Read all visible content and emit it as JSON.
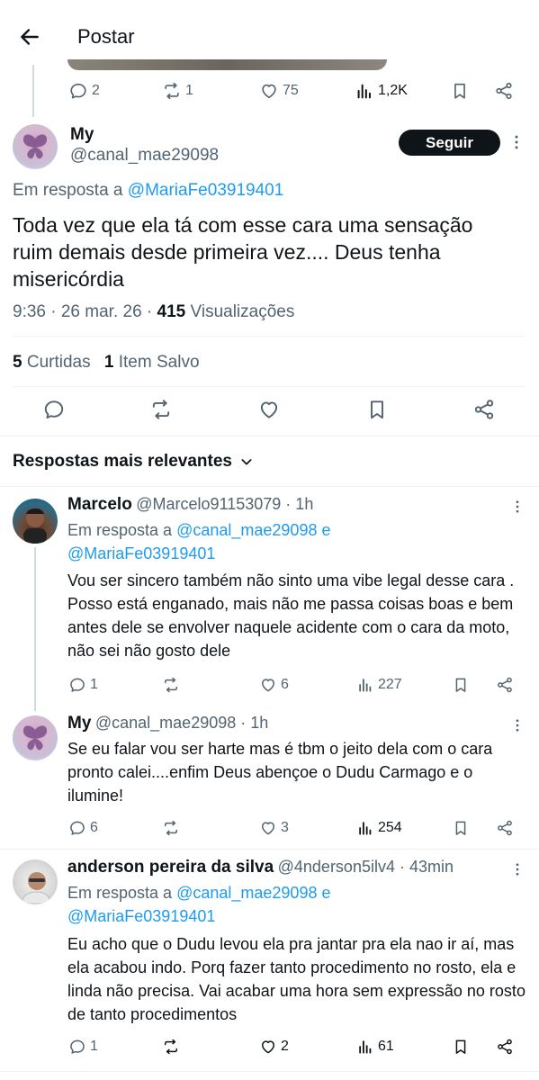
{
  "header": {
    "title": "Postar"
  },
  "prev_post_actions": {
    "replies": "2",
    "reposts": "1",
    "likes": "75",
    "views": "1,2K"
  },
  "main_post": {
    "name": "My",
    "handle": "@canal_mae29098",
    "follow_label": "Seguir",
    "reply_prefix": "Em resposta a",
    "reply_to": "@MariaFe03919401",
    "text": "Toda vez que ela tá com esse cara uma sensação ruim demais desde primeira vez.... Deus tenha misericórdia",
    "time": "9:36 · 26 mar. 26 ·",
    "views_count": "415",
    "views_label": "Visualizações",
    "likes_count": "5",
    "likes_label": "Curtidas",
    "saves_count": "1",
    "saves_label": "Item Salvo"
  },
  "sort_label": "Respostas mais relevantes",
  "replies": [
    {
      "name": "Marcelo",
      "handle": "@Marcelo91153079 · 1h",
      "reply_prefix": "Em resposta a",
      "reply_to_1": "@canal_mae29098 e",
      "reply_to_2": "@MariaFe03919401",
      "text": "Vou ser sincero também não sinto uma vibe legal desse cara . Posso está enganado, mais não me passa coisas boas e bem antes dele se envolver naquele acidente com o cara da moto, não sei não gosto dele",
      "replies": "1",
      "reposts": "",
      "likes": "6",
      "views": "227"
    },
    {
      "name": "My",
      "handle": "@canal_mae29098 · 1h",
      "text": "Se eu falar vou ser harte mas é tbm o jeito dela com o cara pronto calei....enfim Deus abençoe o Dudu Carmago e o ilumine!",
      "replies": "6",
      "reposts": "",
      "likes": "3",
      "views": "254"
    },
    {
      "name": "anderson pereira da silva",
      "handle": "@4nderson5ilv4 · 43min",
      "reply_prefix": "Em resposta a",
      "reply_to_1": "@canal_mae29098 e",
      "reply_to_2": "@MariaFe03919401",
      "text": "Eu acho que o Dudu levou ela pra jantar pra ela nao ir aí, mas ela acabou indo. Porq fazer tanto procedimento no rosto, ela e linda não precisa. Vai acabar uma hora sem expressão no rosto de tanto procedimentos",
      "replies": "1",
      "reposts": "",
      "likes": "2",
      "views": "61"
    }
  ],
  "icons": {
    "back": "arrow-left-icon",
    "reply": "comment-icon",
    "repost": "repost-icon",
    "like": "heart-icon",
    "views": "bar-chart-icon",
    "bookmark": "bookmark-icon",
    "share": "share-icon",
    "more": "more-vertical-icon",
    "chevron": "chevron-down-icon"
  },
  "colors": {
    "accent": "#1d9bf0",
    "text": "#0f1419",
    "muted": "#536471",
    "follow_bg": "#0f1419"
  }
}
